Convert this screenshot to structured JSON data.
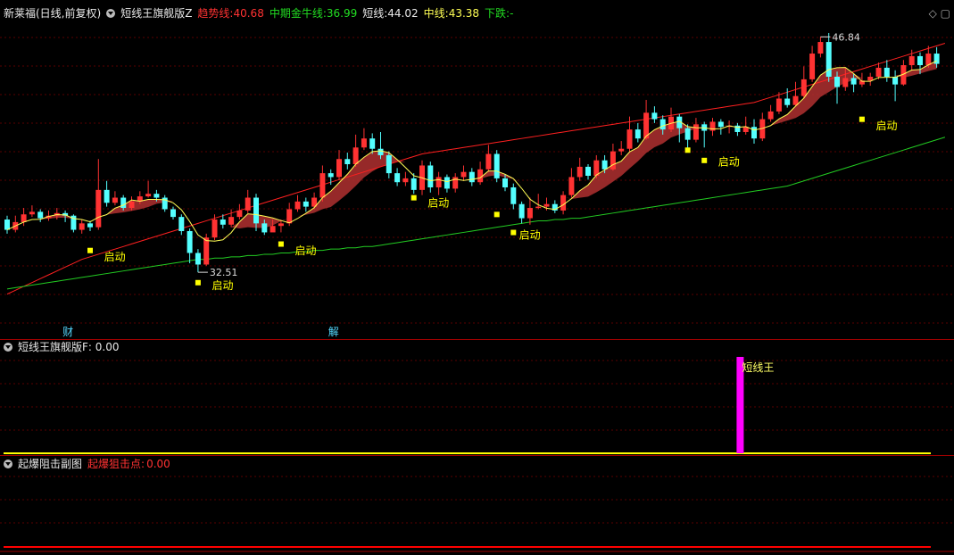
{
  "main_header": {
    "stock": "新莱福(日线,前复权)",
    "indicator": "短线王旗舰版Z",
    "trend_label": "趋势线:",
    "trend_value": "40.68",
    "mid_label": "中期金牛线:",
    "mid_value": "36.99",
    "short_label": "短线:",
    "short_value": "44.02",
    "middle_label": "中线:",
    "middle_value": "43.38",
    "down_label": "下跌:",
    "down_value": "-"
  },
  "sub1_header": {
    "indicator": "短线王旗舰版F",
    "value": ": 0.00"
  },
  "sub2_header": {
    "indicator": "起爆阻击副图",
    "label": "起爆狙击点:",
    "value": "0.00"
  },
  "annotations": {
    "signal_label": "启动",
    "high_label": "46.84",
    "low_label": "32.51",
    "cai_marker": "财",
    "jie_marker": "解",
    "duanxianwang": "短线王"
  },
  "colors": {
    "up": "#ff3232",
    "down": "#54ffff",
    "ribbon": "#b03030",
    "short_line": "#ffff55",
    "trend_line": "#ff2020",
    "mid_line": "#22cc22",
    "signal": "#ffff00",
    "magenta": "#ff00ff"
  },
  "chart_data": {
    "type": "candlestick",
    "ohlc": [
      [
        36.6,
        35.8,
        36.9,
        35.5
      ],
      [
        35.8,
        36.4,
        36.9,
        35.6
      ],
      [
        36.4,
        37.0,
        37.5,
        36.1
      ],
      [
        37.0,
        37.2,
        37.7,
        36.8
      ],
      [
        37.2,
        36.7,
        37.4,
        36.4
      ],
      [
        36.7,
        36.9,
        37.3,
        36.5
      ],
      [
        36.9,
        37.1,
        37.5,
        36.6
      ],
      [
        37.1,
        36.9,
        37.3,
        36.4
      ],
      [
        36.9,
        35.8,
        37.0,
        35.6
      ],
      [
        35.8,
        36.3,
        36.6,
        35.5
      ],
      [
        36.3,
        36.0,
        36.5,
        35.7
      ],
      [
        36.0,
        38.9,
        41.3,
        35.8
      ],
      [
        38.9,
        37.9,
        39.6,
        37.6
      ],
      [
        37.9,
        38.3,
        38.8,
        37.7
      ],
      [
        38.3,
        37.5,
        38.5,
        37.3
      ],
      [
        37.5,
        38.0,
        38.4,
        37.3
      ],
      [
        38.0,
        38.4,
        38.8,
        37.8
      ],
      [
        38.4,
        38.6,
        39.6,
        38.3
      ],
      [
        38.6,
        38.3,
        38.9,
        38.0
      ],
      [
        38.3,
        37.4,
        38.5,
        37.2
      ],
      [
        37.4,
        36.8,
        37.6,
        36.6
      ],
      [
        36.8,
        35.7,
        37.0,
        35.4
      ],
      [
        35.7,
        34.0,
        35.9,
        33.2
      ],
      [
        34.0,
        33.1,
        34.3,
        32.5
      ],
      [
        33.1,
        35.2,
        35.5,
        33.0
      ],
      [
        35.2,
        36.6,
        37.0,
        35.0
      ],
      [
        36.6,
        36.2,
        37.0,
        35.9
      ],
      [
        36.2,
        36.8,
        37.4,
        36.0
      ],
      [
        36.8,
        37.3,
        37.8,
        36.6
      ],
      [
        37.3,
        38.3,
        38.9,
        37.1
      ],
      [
        38.3,
        36.3,
        38.6,
        35.7
      ],
      [
        36.3,
        35.6,
        36.6,
        35.4
      ],
      [
        35.6,
        36.1,
        36.6,
        35.8
      ],
      [
        36.1,
        36.3,
        36.6,
        35.6
      ],
      [
        36.3,
        37.4,
        37.9,
        36.1
      ],
      [
        37.4,
        38.0,
        38.5,
        37.2
      ],
      [
        38.0,
        37.6,
        38.3,
        37.2
      ],
      [
        37.6,
        38.3,
        38.7,
        37.4
      ],
      [
        38.3,
        40.2,
        40.8,
        38.0
      ],
      [
        40.2,
        39.9,
        40.5,
        39.3
      ],
      [
        39.9,
        41.3,
        42.0,
        39.7
      ],
      [
        41.3,
        40.9,
        41.8,
        40.5
      ],
      [
        40.9,
        42.2,
        43.2,
        40.7
      ],
      [
        42.2,
        42.9,
        43.7,
        42.0
      ],
      [
        42.9,
        42.1,
        43.3,
        41.7
      ],
      [
        42.1,
        41.6,
        43.4,
        41.3
      ],
      [
        41.6,
        40.2,
        41.9,
        39.8
      ],
      [
        40.2,
        39.5,
        40.6,
        39.2
      ],
      [
        39.5,
        39.8,
        40.3,
        39.2
      ],
      [
        39.8,
        38.9,
        40.2,
        38.6
      ],
      [
        38.9,
        40.8,
        41.2,
        38.5
      ],
      [
        40.8,
        39.1,
        41.1,
        38.7
      ],
      [
        39.1,
        39.9,
        40.3,
        38.5
      ],
      [
        39.9,
        39.0,
        40.1,
        38.7
      ],
      [
        39.0,
        39.9,
        40.2,
        38.7
      ],
      [
        39.9,
        40.3,
        40.8,
        39.6
      ],
      [
        40.3,
        39.5,
        40.6,
        39.2
      ],
      [
        39.5,
        40.5,
        41.1,
        39.3
      ],
      [
        40.5,
        41.7,
        42.4,
        40.3
      ],
      [
        41.7,
        39.8,
        42.0,
        39.5
      ],
      [
        39.8,
        39.1,
        40.1,
        38.8
      ],
      [
        39.1,
        37.8,
        39.4,
        37.4
      ],
      [
        37.8,
        36.7,
        38.0,
        36.3
      ],
      [
        36.7,
        37.5,
        38.3,
        36.2
      ],
      [
        37.5,
        37.6,
        38.6,
        37.4
      ],
      [
        37.6,
        37.8,
        38.3,
        37.3
      ],
      [
        37.8,
        37.3,
        38.1,
        37.1
      ],
      [
        37.3,
        38.5,
        38.8,
        37.0
      ],
      [
        38.5,
        39.9,
        40.6,
        38.3
      ],
      [
        39.9,
        40.7,
        41.4,
        39.6
      ],
      [
        40.7,
        40.0,
        40.9,
        39.7
      ],
      [
        40.0,
        41.2,
        41.6,
        39.8
      ],
      [
        41.2,
        40.5,
        41.6,
        40.2
      ],
      [
        40.5,
        41.9,
        42.5,
        40.4
      ],
      [
        41.9,
        42.1,
        42.7,
        41.6
      ],
      [
        42.1,
        43.6,
        44.6,
        41.9
      ],
      [
        43.6,
        42.9,
        44.1,
        42.6
      ],
      [
        42.9,
        44.9,
        45.9,
        42.8
      ],
      [
        44.9,
        44.4,
        45.4,
        44.1
      ],
      [
        44.4,
        43.6,
        44.7,
        43.2
      ],
      [
        43.6,
        44.6,
        45.3,
        43.4
      ],
      [
        44.6,
        43.7,
        44.8,
        42.6
      ],
      [
        43.7,
        42.8,
        44.0,
        42.1
      ],
      [
        42.8,
        44.0,
        44.5,
        42.6
      ],
      [
        44.0,
        43.5,
        44.2,
        42.2
      ],
      [
        43.5,
        44.2,
        44.5,
        43.1
      ],
      [
        44.2,
        43.8,
        44.4,
        43.2
      ],
      [
        43.8,
        43.9,
        44.3,
        43.3
      ],
      [
        43.9,
        43.4,
        44.1,
        43.1
      ],
      [
        43.4,
        43.8,
        44.6,
        43.2
      ],
      [
        43.8,
        42.9,
        44.4,
        42.5
      ],
      [
        42.9,
        44.4,
        44.9,
        42.7
      ],
      [
        44.4,
        45.0,
        45.5,
        44.2
      ],
      [
        45.0,
        46.0,
        46.5,
        44.8
      ],
      [
        46.0,
        45.5,
        46.8,
        45.3
      ],
      [
        45.5,
        46.2,
        47.3,
        45.4
      ],
      [
        46.2,
        47.5,
        48.5,
        46.0
      ],
      [
        47.5,
        49.5,
        50.1,
        47.3
      ],
      [
        49.5,
        50.4,
        50.8,
        49.2
      ],
      [
        50.4,
        47.7,
        51.1,
        47.3
      ],
      [
        47.7,
        46.9,
        48.1,
        45.6
      ],
      [
        46.9,
        47.6,
        48.4,
        46.6
      ],
      [
        47.6,
        47.1,
        47.9,
        46.5
      ],
      [
        47.1,
        47.4,
        48.0,
        46.9
      ],
      [
        47.4,
        47.7,
        48.0,
        47.0
      ],
      [
        47.7,
        48.4,
        48.8,
        47.5
      ],
      [
        48.4,
        47.7,
        49.0,
        47.3
      ],
      [
        47.7,
        47.1,
        48.2,
        45.8
      ],
      [
        47.1,
        48.6,
        49.0,
        47.0
      ],
      [
        48.6,
        49.3,
        49.8,
        48.2
      ],
      [
        49.3,
        48.6,
        49.6,
        47.9
      ],
      [
        48.6,
        49.5,
        50.1,
        48.4
      ],
      [
        49.5,
        48.7,
        50.0,
        48.4
      ]
    ],
    "trend_line": [
      30.8,
      31.1,
      31.4,
      31.7,
      32.0,
      32.3,
      32.6,
      32.9,
      33.2,
      33.5,
      33.7,
      33.9,
      34.1,
      34.3,
      34.5,
      34.7,
      34.9,
      35.1,
      35.3,
      35.5,
      35.7,
      35.9,
      36.1,
      36.3,
      36.5,
      36.7,
      36.9,
      37.1,
      37.3,
      37.5,
      37.7,
      37.9,
      38.1,
      38.3,
      38.5,
      38.7,
      38.9,
      39.1,
      39.3,
      39.5,
      39.7,
      39.9,
      40.1,
      40.3,
      40.5,
      40.7,
      40.9,
      41.1,
      41.3,
      41.5,
      41.7,
      41.8,
      41.9,
      42.0,
      42.1,
      42.2,
      42.3,
      42.4,
      42.5,
      42.6,
      42.7,
      42.8,
      42.9,
      43.0,
      43.1,
      43.2,
      43.3,
      43.4,
      43.5,
      43.6,
      43.7,
      43.8,
      43.9,
      44.0,
      44.1,
      44.2,
      44.3,
      44.4,
      44.5,
      44.6,
      44.7,
      44.8,
      44.9,
      45.0,
      45.1,
      45.2,
      45.3,
      45.4,
      45.5,
      45.6,
      45.7,
      45.9,
      46.1,
      46.3,
      46.5,
      46.7,
      46.9,
      47.1,
      47.3,
      47.5,
      47.7,
      47.9,
      48.1,
      48.3,
      48.5,
      48.7,
      48.9,
      49.1,
      49.3,
      49.5,
      49.7,
      49.9,
      50.1,
      50.3
    ],
    "mid_line": [
      31.2,
      31.3,
      31.4,
      31.5,
      31.6,
      31.7,
      31.8,
      31.9,
      32.0,
      32.1,
      32.2,
      32.3,
      32.4,
      32.5,
      32.6,
      32.7,
      32.8,
      32.9,
      33.0,
      33.1,
      33.2,
      33.3,
      33.4,
      33.5,
      33.5,
      33.6,
      33.6,
      33.7,
      33.7,
      33.8,
      33.8,
      33.9,
      33.9,
      34.0,
      34.0,
      34.1,
      34.1,
      34.2,
      34.2,
      34.3,
      34.3,
      34.4,
      34.4,
      34.5,
      34.5,
      34.6,
      34.7,
      34.8,
      34.9,
      35.0,
      35.1,
      35.2,
      35.3,
      35.4,
      35.5,
      35.6,
      35.7,
      35.8,
      35.9,
      36.0,
      36.1,
      36.2,
      36.3,
      36.4,
      36.5,
      36.5,
      36.6,
      36.6,
      36.7,
      36.7,
      36.8,
      36.9,
      37.0,
      37.1,
      37.2,
      37.3,
      37.4,
      37.5,
      37.6,
      37.7,
      37.8,
      37.9,
      38.0,
      38.1,
      38.2,
      38.3,
      38.4,
      38.5,
      38.6,
      38.7,
      38.8,
      38.9,
      39.0,
      39.1,
      39.2,
      39.4,
      39.6,
      39.8,
      40.0,
      40.2,
      40.4,
      40.6,
      40.8,
      41.0,
      41.2,
      41.4,
      41.6,
      41.8,
      42.0,
      42.2,
      42.4,
      42.6,
      42.8,
      43.0
    ],
    "signals": [
      {
        "i": 10,
        "y": 34.4
      },
      {
        "i": 23,
        "y": 31.9
      },
      {
        "i": 33,
        "y": 34.9
      },
      {
        "i": 49,
        "y": 38.5
      },
      {
        "i": 59,
        "y": 37.2
      },
      {
        "i": 61,
        "y": 35.8
      },
      {
        "i": 82,
        "y": 42.2
      },
      {
        "i": 84,
        "y": 41.4
      },
      {
        "i": 103,
        "y": 44.6
      }
    ],
    "start_labels": [
      {
        "i": 12,
        "y": 33.4
      },
      {
        "i": 25,
        "y": 31.2
      },
      {
        "i": 35,
        "y": 33.9
      },
      {
        "i": 51,
        "y": 37.6
      },
      {
        "i": 62,
        "y": 35.1
      },
      {
        "i": 86,
        "y": 40.8
      },
      {
        "i": 105,
        "y": 43.6
      }
    ],
    "sub1_bar_index": 88,
    "ylim_main": [
      28,
      52
    ]
  }
}
